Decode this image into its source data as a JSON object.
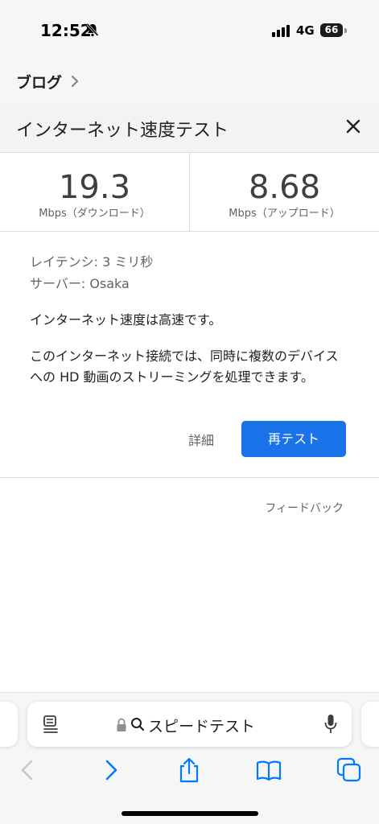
{
  "status_bar": {
    "time": "12:52",
    "network": "4G",
    "battery": "66"
  },
  "breadcrumb": {
    "label": "ブログ"
  },
  "card": {
    "title": "インターネット速度テスト"
  },
  "results": {
    "download_value": "19.3",
    "download_unit": "Mbps（ダウンロード）",
    "upload_value": "8.68",
    "upload_unit": "Mbps（アップロード）"
  },
  "details": {
    "latency": "レイテンシ: 3 ミリ秒",
    "server": "サーバー: Osaka",
    "summary": "インターネット速度は高速です。",
    "description": "このインターネット接続では、同時に複数のデバイスへの HD 動画のストリーミングを処理できます。"
  },
  "actions": {
    "details_label": "詳細",
    "retest_label": "再テスト",
    "feedback_label": "フィードバック"
  },
  "browser": {
    "address_text": "スピードテスト"
  },
  "colors": {
    "accent": "#1a73e8",
    "safari_blue": "#007aff"
  },
  "icons": [
    "bell-slash-icon",
    "chevron-right-icon",
    "close-icon",
    "reader-icon",
    "lock-icon",
    "search-icon",
    "microphone-icon",
    "back-icon",
    "forward-icon",
    "share-icon",
    "bookmarks-icon",
    "tabs-icon"
  ]
}
